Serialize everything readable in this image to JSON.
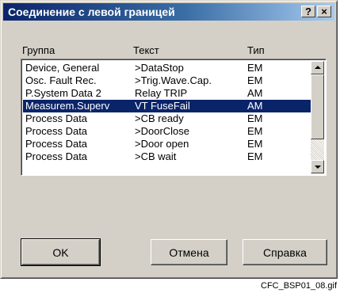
{
  "window": {
    "title": "Соединение с левой границей",
    "help_button": "?",
    "close_button": "×"
  },
  "columns": {
    "group": "Группа",
    "text": "Текст",
    "type": "Тип"
  },
  "rows": [
    {
      "group": "Device, General",
      "text": ">DataStop",
      "type": "EM",
      "selected": false
    },
    {
      "group": "Osc. Fault Rec.",
      "text": ">Trig.Wave.Cap.",
      "type": "EM",
      "selected": false
    },
    {
      "group": "P.System Data 2",
      "text": "Relay TRIP",
      "type": "AM",
      "selected": false
    },
    {
      "group": "Measurem.Superv",
      "text": "VT FuseFail",
      "type": "AM",
      "selected": true
    },
    {
      "group": "Process Data",
      "text": ">CB ready",
      "type": "EM",
      "selected": false
    },
    {
      "group": "Process Data",
      "text": ">DoorClose",
      "type": "EM",
      "selected": false
    },
    {
      "group": "Process Data",
      "text": ">Door open",
      "type": "EM",
      "selected": false
    },
    {
      "group": "Process Data",
      "text": ">CB wait",
      "type": "EM",
      "selected": false
    }
  ],
  "buttons": {
    "ok": "OK",
    "cancel": "Отмена",
    "help": "Справка"
  },
  "caption": "CFC_BSP01_08.gif",
  "colors": {
    "title_active": "#0a246a",
    "selection": "#0a246a",
    "face": "#d4d0c8"
  }
}
